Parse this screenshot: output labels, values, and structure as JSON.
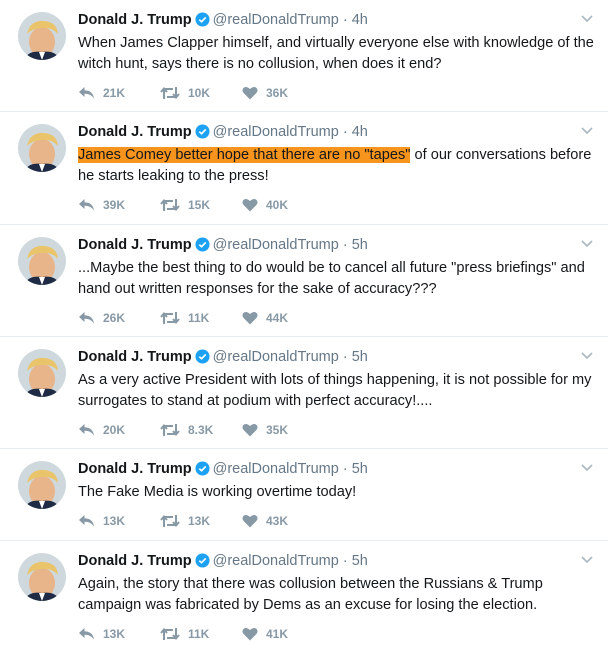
{
  "tweets": [
    {
      "name": "Donald J. Trump",
      "handle": "@realDonaldTrump",
      "dot": "·",
      "time": "4h",
      "text_pre": "When James Clapper himself, and virtually everyone else with knowledge of the witch hunt, says there is no collusion, when does it end?",
      "text_hl": "",
      "text_post": "",
      "replies": "21K",
      "retweets": "10K",
      "likes": "36K"
    },
    {
      "name": "Donald J. Trump",
      "handle": "@realDonaldTrump",
      "dot": "·",
      "time": "4h",
      "text_pre": "",
      "text_hl": "James Comey better hope that there are no \"tapes\"",
      "text_post": " of our conversations before he starts leaking to the press!",
      "replies": "39K",
      "retweets": "15K",
      "likes": "40K"
    },
    {
      "name": "Donald J. Trump",
      "handle": "@realDonaldTrump",
      "dot": "·",
      "time": "5h",
      "text_pre": "...Maybe the best thing to do would be to cancel all future \"press briefings\" and hand out written responses for the sake of accuracy???",
      "text_hl": "",
      "text_post": "",
      "replies": "26K",
      "retweets": "11K",
      "likes": "44K"
    },
    {
      "name": "Donald J. Trump",
      "handle": "@realDonaldTrump",
      "dot": "·",
      "time": "5h",
      "text_pre": "As a very active President with lots of things happening, it is not possible for my surrogates to stand at podium with perfect accuracy!....",
      "text_hl": "",
      "text_post": "",
      "replies": "20K",
      "retweets": "8.3K",
      "likes": "35K"
    },
    {
      "name": "Donald J. Trump",
      "handle": "@realDonaldTrump",
      "dot": "·",
      "time": "5h",
      "text_pre": "The Fake Media is working overtime today!",
      "text_hl": "",
      "text_post": "",
      "replies": "13K",
      "retweets": "13K",
      "likes": "43K"
    },
    {
      "name": "Donald J. Trump",
      "handle": "@realDonaldTrump",
      "dot": "·",
      "time": "5h",
      "text_pre": "Again, the story that there was collusion between the Russians & Trump campaign was fabricated by Dems as an excuse for losing the election.",
      "text_hl": "",
      "text_post": "",
      "replies": "13K",
      "retweets": "11K",
      "likes": "41K"
    }
  ],
  "icons": {
    "verified": "verified-badge-icon",
    "reply": "reply-icon",
    "retweet": "retweet-icon",
    "like": "heart-icon",
    "menu": "chevron-down-icon"
  },
  "colors": {
    "highlight": "#f7941d",
    "verified": "#1da1f2",
    "action_gray": "#8899a6",
    "secondary_text": "#657786"
  }
}
